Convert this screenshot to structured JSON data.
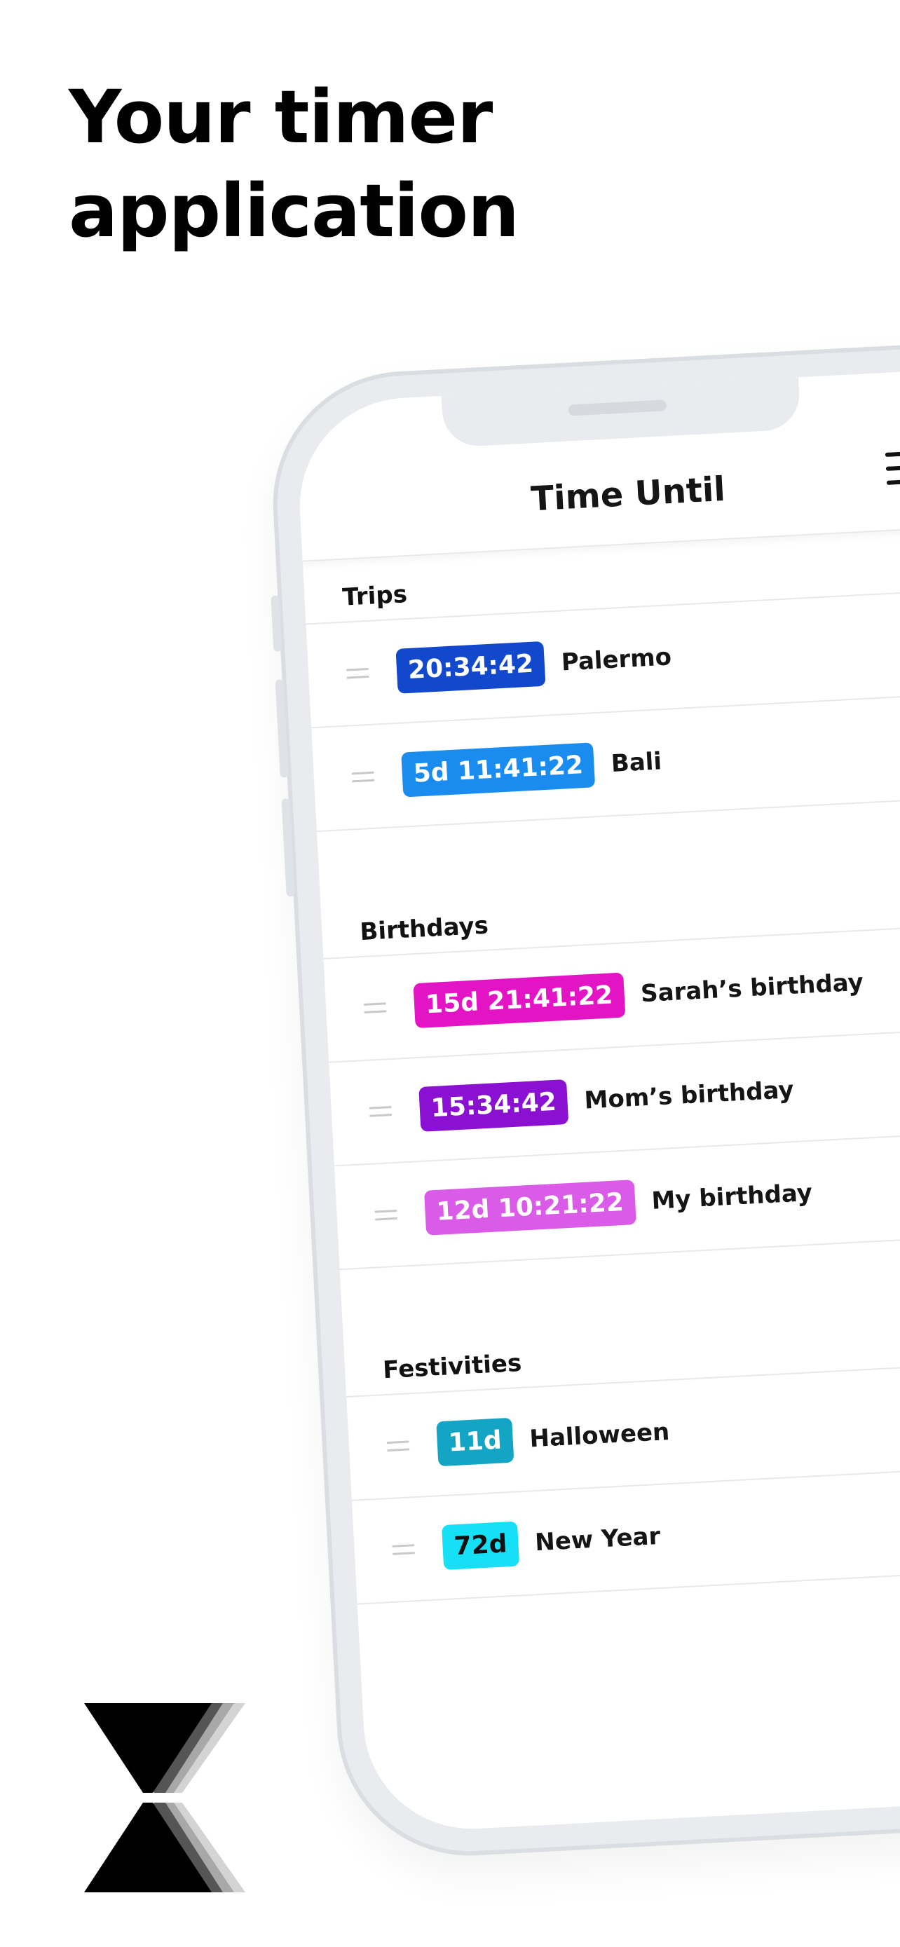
{
  "headline": {
    "line1": "Your timer",
    "line2": "application"
  },
  "app": {
    "title": "Time Until"
  },
  "icons": {
    "menu": "hamburger-menu-icon",
    "sort": "sort-icon",
    "drag": "drag-handle-icon",
    "logo": "hourglass-logo"
  },
  "sort_glyph": "↓↑",
  "sections": [
    {
      "title": "Trips",
      "items": [
        {
          "badge": "20:34:42",
          "name": "Palermo",
          "color": "#1148cc"
        },
        {
          "badge": "5d 11:41:22",
          "name": "Bali",
          "color": "#1a8cf0"
        }
      ]
    },
    {
      "title": "Birthdays",
      "items": [
        {
          "badge": "15d 21:41:22",
          "name": "Sarah’s birthday",
          "color": "#e214c4"
        },
        {
          "badge": "15:34:42",
          "name": "Mom’s birthday",
          "color": "#8a10d2"
        },
        {
          "badge": "12d 10:21:22",
          "name": "My birthday",
          "color": "#d95be8"
        }
      ]
    },
    {
      "title": "Festivities",
      "items": [
        {
          "badge": "11d",
          "name": "Halloween",
          "color": "#14a4c4"
        },
        {
          "badge": "72d",
          "name": "New Year",
          "color": "#16e0f5"
        }
      ]
    }
  ]
}
